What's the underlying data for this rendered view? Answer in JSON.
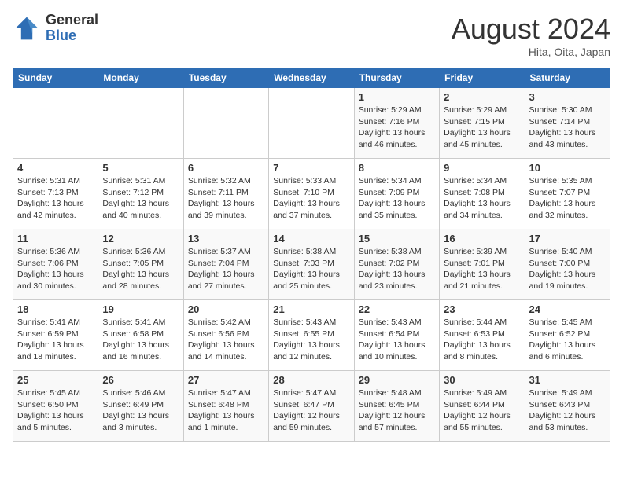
{
  "header": {
    "logo_general": "General",
    "logo_blue": "Blue",
    "month_year": "August 2024",
    "location": "Hita, Oita, Japan"
  },
  "days_of_week": [
    "Sunday",
    "Monday",
    "Tuesday",
    "Wednesday",
    "Thursday",
    "Friday",
    "Saturday"
  ],
  "weeks": [
    [
      {
        "day": "",
        "info": ""
      },
      {
        "day": "",
        "info": ""
      },
      {
        "day": "",
        "info": ""
      },
      {
        "day": "",
        "info": ""
      },
      {
        "day": "1",
        "info": "Sunrise: 5:29 AM\nSunset: 7:16 PM\nDaylight: 13 hours\nand 46 minutes."
      },
      {
        "day": "2",
        "info": "Sunrise: 5:29 AM\nSunset: 7:15 PM\nDaylight: 13 hours\nand 45 minutes."
      },
      {
        "day": "3",
        "info": "Sunrise: 5:30 AM\nSunset: 7:14 PM\nDaylight: 13 hours\nand 43 minutes."
      }
    ],
    [
      {
        "day": "4",
        "info": "Sunrise: 5:31 AM\nSunset: 7:13 PM\nDaylight: 13 hours\nand 42 minutes."
      },
      {
        "day": "5",
        "info": "Sunrise: 5:31 AM\nSunset: 7:12 PM\nDaylight: 13 hours\nand 40 minutes."
      },
      {
        "day": "6",
        "info": "Sunrise: 5:32 AM\nSunset: 7:11 PM\nDaylight: 13 hours\nand 39 minutes."
      },
      {
        "day": "7",
        "info": "Sunrise: 5:33 AM\nSunset: 7:10 PM\nDaylight: 13 hours\nand 37 minutes."
      },
      {
        "day": "8",
        "info": "Sunrise: 5:34 AM\nSunset: 7:09 PM\nDaylight: 13 hours\nand 35 minutes."
      },
      {
        "day": "9",
        "info": "Sunrise: 5:34 AM\nSunset: 7:08 PM\nDaylight: 13 hours\nand 34 minutes."
      },
      {
        "day": "10",
        "info": "Sunrise: 5:35 AM\nSunset: 7:07 PM\nDaylight: 13 hours\nand 32 minutes."
      }
    ],
    [
      {
        "day": "11",
        "info": "Sunrise: 5:36 AM\nSunset: 7:06 PM\nDaylight: 13 hours\nand 30 minutes."
      },
      {
        "day": "12",
        "info": "Sunrise: 5:36 AM\nSunset: 7:05 PM\nDaylight: 13 hours\nand 28 minutes."
      },
      {
        "day": "13",
        "info": "Sunrise: 5:37 AM\nSunset: 7:04 PM\nDaylight: 13 hours\nand 27 minutes."
      },
      {
        "day": "14",
        "info": "Sunrise: 5:38 AM\nSunset: 7:03 PM\nDaylight: 13 hours\nand 25 minutes."
      },
      {
        "day": "15",
        "info": "Sunrise: 5:38 AM\nSunset: 7:02 PM\nDaylight: 13 hours\nand 23 minutes."
      },
      {
        "day": "16",
        "info": "Sunrise: 5:39 AM\nSunset: 7:01 PM\nDaylight: 13 hours\nand 21 minutes."
      },
      {
        "day": "17",
        "info": "Sunrise: 5:40 AM\nSunset: 7:00 PM\nDaylight: 13 hours\nand 19 minutes."
      }
    ],
    [
      {
        "day": "18",
        "info": "Sunrise: 5:41 AM\nSunset: 6:59 PM\nDaylight: 13 hours\nand 18 minutes."
      },
      {
        "day": "19",
        "info": "Sunrise: 5:41 AM\nSunset: 6:58 PM\nDaylight: 13 hours\nand 16 minutes."
      },
      {
        "day": "20",
        "info": "Sunrise: 5:42 AM\nSunset: 6:56 PM\nDaylight: 13 hours\nand 14 minutes."
      },
      {
        "day": "21",
        "info": "Sunrise: 5:43 AM\nSunset: 6:55 PM\nDaylight: 13 hours\nand 12 minutes."
      },
      {
        "day": "22",
        "info": "Sunrise: 5:43 AM\nSunset: 6:54 PM\nDaylight: 13 hours\nand 10 minutes."
      },
      {
        "day": "23",
        "info": "Sunrise: 5:44 AM\nSunset: 6:53 PM\nDaylight: 13 hours\nand 8 minutes."
      },
      {
        "day": "24",
        "info": "Sunrise: 5:45 AM\nSunset: 6:52 PM\nDaylight: 13 hours\nand 6 minutes."
      }
    ],
    [
      {
        "day": "25",
        "info": "Sunrise: 5:45 AM\nSunset: 6:50 PM\nDaylight: 13 hours\nand 5 minutes."
      },
      {
        "day": "26",
        "info": "Sunrise: 5:46 AM\nSunset: 6:49 PM\nDaylight: 13 hours\nand 3 minutes."
      },
      {
        "day": "27",
        "info": "Sunrise: 5:47 AM\nSunset: 6:48 PM\nDaylight: 13 hours\nand 1 minute."
      },
      {
        "day": "28",
        "info": "Sunrise: 5:47 AM\nSunset: 6:47 PM\nDaylight: 12 hours\nand 59 minutes."
      },
      {
        "day": "29",
        "info": "Sunrise: 5:48 AM\nSunset: 6:45 PM\nDaylight: 12 hours\nand 57 minutes."
      },
      {
        "day": "30",
        "info": "Sunrise: 5:49 AM\nSunset: 6:44 PM\nDaylight: 12 hours\nand 55 minutes."
      },
      {
        "day": "31",
        "info": "Sunrise: 5:49 AM\nSunset: 6:43 PM\nDaylight: 12 hours\nand 53 minutes."
      }
    ]
  ]
}
